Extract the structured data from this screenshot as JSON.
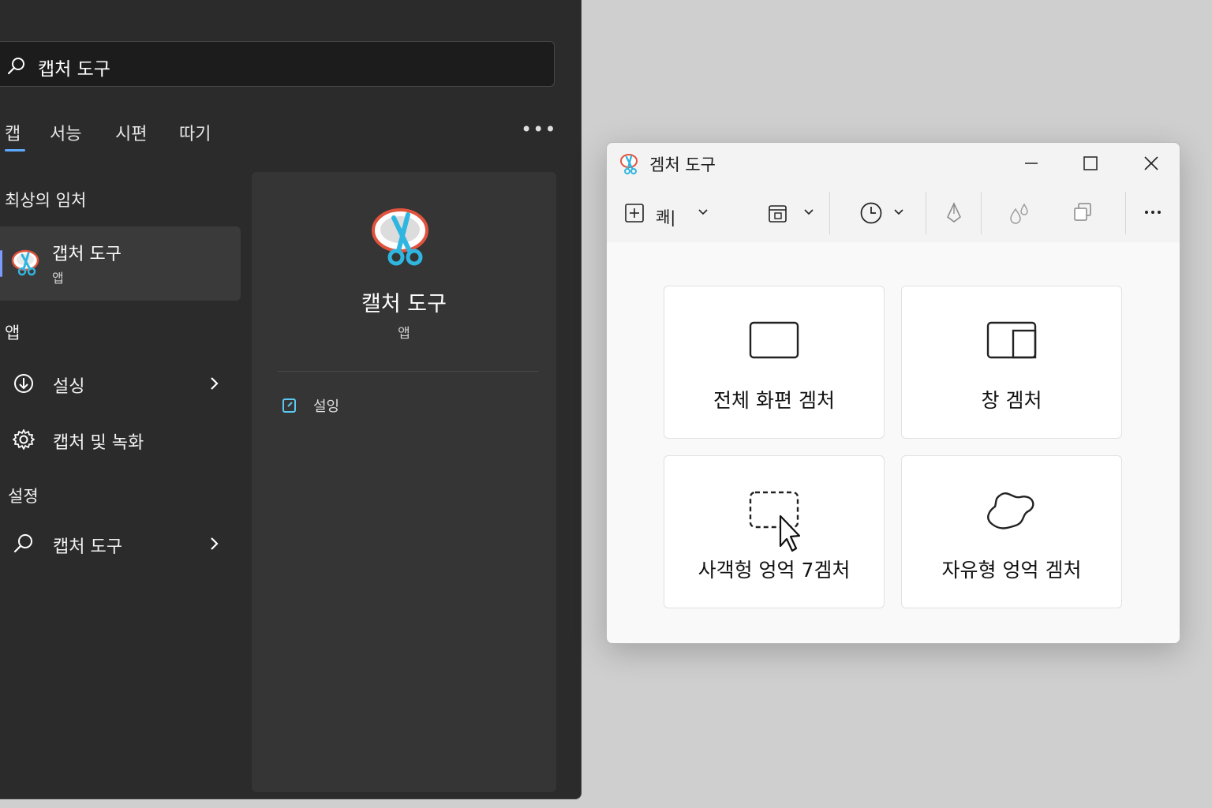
{
  "search": {
    "query": "캡처 도구"
  },
  "tabs": [
    {
      "label": "캡",
      "active": true
    },
    {
      "label": "서능"
    },
    {
      "label": "시편"
    },
    {
      "label": "따기"
    }
  ],
  "more": "•••",
  "best_match": {
    "heading": "최상의 임처",
    "title": "갭처 도구",
    "subtitle": "앱"
  },
  "apps_section": {
    "heading": "앱",
    "items": [
      {
        "label": "설싱",
        "icon": "download-circle-icon"
      },
      {
        "label": "캡처 및 녹화",
        "icon": "gear-icon"
      }
    ]
  },
  "settings_section": {
    "heading": "설졍",
    "items": [
      {
        "label": "캡처 도구",
        "icon": "search-icon"
      }
    ]
  },
  "preview": {
    "title": "캘처 도구",
    "subtitle": "앱",
    "action_label": "설잉"
  },
  "snip": {
    "title": "겜처 도구",
    "new_label": "쾌|",
    "cards": [
      {
        "label": "전체 화편 겜처",
        "icon": "fullscreen-snip-icon"
      },
      {
        "label": "창 겜처",
        "icon": "window-snip-icon"
      },
      {
        "label": "사객헝 엉억 7겜처",
        "icon": "rectangle-snip-icon"
      },
      {
        "label": "자유형 엉억 겜처",
        "icon": "freeform-snip-icon"
      }
    ]
  },
  "colors": {
    "accent": "#5ea9ff",
    "panel_bg": "#2b2b2b",
    "window_bg": "#f3f3f3"
  }
}
